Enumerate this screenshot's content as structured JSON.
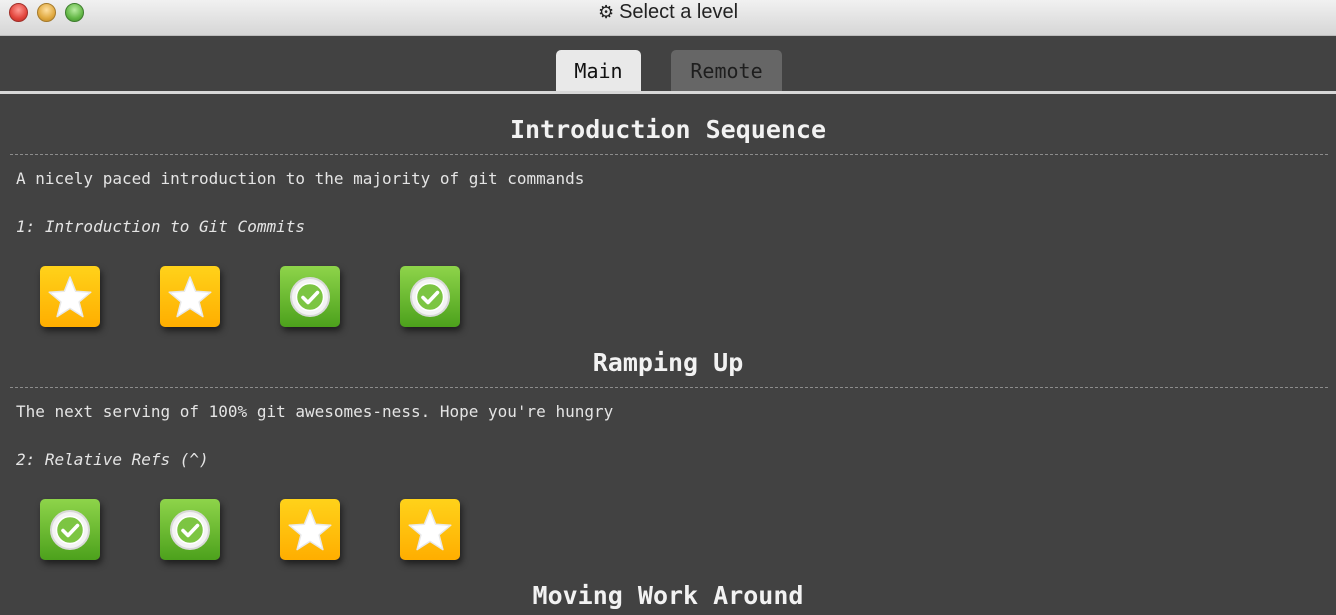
{
  "window": {
    "title": "Select a level",
    "title_icon": "gear-icon"
  },
  "tabs": [
    {
      "label": "Main",
      "active": true
    },
    {
      "label": "Remote",
      "active": false
    }
  ],
  "sections": [
    {
      "title": "Introduction Sequence",
      "description": "A nicely paced introduction to the majority of git commands",
      "selected_level": "1: Introduction to Git Commits",
      "levels": [
        "star",
        "star",
        "check",
        "check"
      ]
    },
    {
      "title": "Ramping Up",
      "description": "The next serving of 100% git awesomes-ness. Hope you're hungry",
      "selected_level": "2: Relative Refs (^)",
      "levels": [
        "check",
        "check",
        "star",
        "star"
      ]
    },
    {
      "title": "Moving Work Around"
    }
  ],
  "colors": {
    "background": "#424242",
    "star_tile": "#ffbf00",
    "check_tile": "#5cb82a",
    "active_tab": "#e9e9e9",
    "inactive_tab": "#666666"
  }
}
